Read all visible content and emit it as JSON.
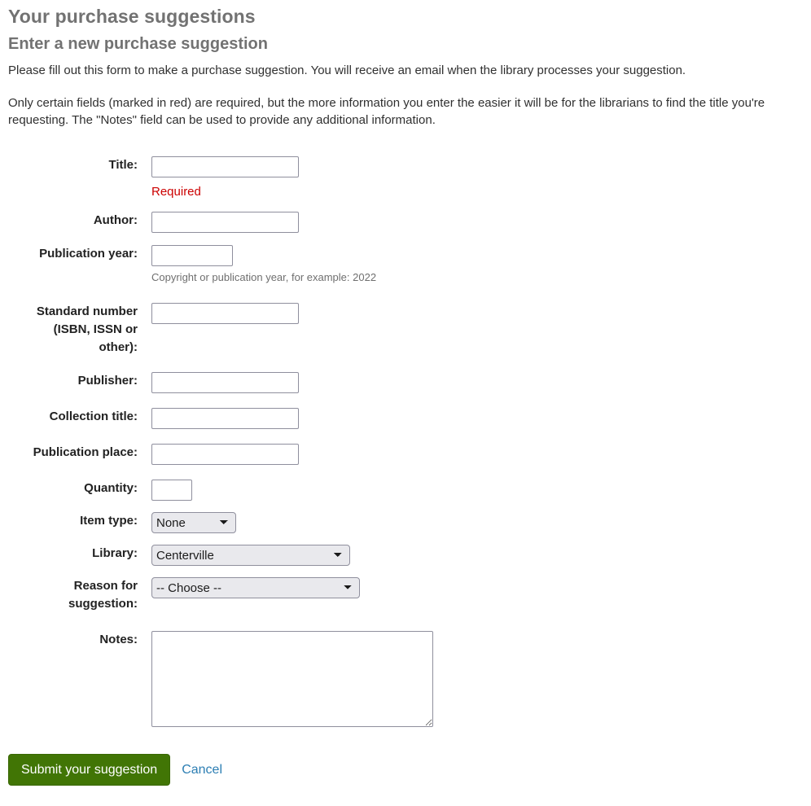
{
  "page": {
    "title": "Your purchase suggestions",
    "form_title": "Enter a new purchase suggestion",
    "intro_1": "Please fill out this form to make a purchase suggestion. You will receive an email when the library processes your suggestion.",
    "intro_2": "Only certain fields (marked in red) are required, but the more information you enter the easier it will be for the librarians to find the title you're requesting. The \"Notes\" field can be used to provide any additional information."
  },
  "fields": {
    "title": {
      "label": "Title:",
      "value": "",
      "placeholder": "",
      "required_note": "Required"
    },
    "author": {
      "label": "Author:",
      "value": "",
      "placeholder": ""
    },
    "publication_year": {
      "label": "Publication year:",
      "value": "",
      "placeholder": "",
      "hint": "Copyright or publication year, for example: 2022"
    },
    "standard_number": {
      "label": "Standard number (ISBN, ISSN or other):",
      "label_line1": "Standard number",
      "label_line2": "(ISBN, ISSN or",
      "label_line3": "other):",
      "value": "",
      "placeholder": ""
    },
    "publisher": {
      "label": "Publisher:",
      "value": "",
      "placeholder": ""
    },
    "collection_title": {
      "label": "Collection title:",
      "value": "",
      "placeholder": ""
    },
    "publication_place": {
      "label": "Publication place:",
      "value": "",
      "placeholder": ""
    },
    "quantity": {
      "label": "Quantity:",
      "value": "",
      "placeholder": ""
    },
    "item_type": {
      "label": "Item type:",
      "selected": "None",
      "options": [
        "None"
      ]
    },
    "library": {
      "label": "Library:",
      "selected": "Centerville",
      "options": [
        "Centerville"
      ]
    },
    "reason": {
      "label": "Reason for suggestion:",
      "label_line1": "Reason for",
      "label_line2": "suggestion:",
      "selected": "-- Choose --",
      "options": [
        "-- Choose --"
      ]
    },
    "notes": {
      "label": "Notes:",
      "value": "",
      "placeholder": ""
    }
  },
  "actions": {
    "submit_label": "Submit your suggestion",
    "cancel_label": "Cancel"
  },
  "colors": {
    "heading": "#727272",
    "required": "#cc0000",
    "submit_bg": "#417505",
    "link": "#2c7eb3",
    "select_bg": "#e9e9ed",
    "input_border": "#8f8f9d"
  }
}
